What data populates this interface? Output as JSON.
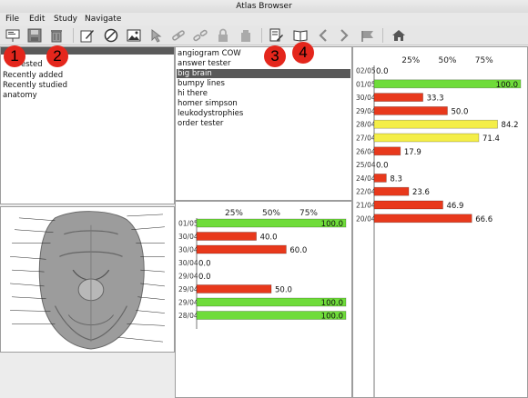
{
  "window": {
    "title": "Atlas Browser"
  },
  "menu": [
    "File",
    "Edit",
    "Study",
    "Navigate"
  ],
  "toolbar": {
    "icons": [
      "presentation-icon",
      "save-icon",
      "trash-icon",
      "edit-icon",
      "no-entry-icon",
      "image-icon",
      "cursor-icon",
      "link-icon",
      "unlink-icon",
      "lock-icon",
      "stack-icon",
      "notes-icon",
      "book-icon",
      "back-arrow-icon",
      "forward-arrow-icon",
      "flag-icon",
      "home-icon"
    ]
  },
  "markers": [
    "1",
    "2",
    "3",
    "4"
  ],
  "left_list": {
    "items": [
      "ested",
      "Recently added",
      "Recently studied",
      "anatomy"
    ]
  },
  "middle_list": {
    "items": [
      "angiogram COW",
      "answer tester",
      "big brain",
      "bumpy lines",
      "hi there",
      "homer simpson",
      "leukodystrophies",
      "order tester"
    ],
    "selected_index": 2
  },
  "colors": {
    "green": "#6fdc3a",
    "red": "#e8391c",
    "yellow": "#f4ee48",
    "selected": "#585858"
  },
  "chart_data": [
    {
      "type": "bar",
      "orientation": "horizontal",
      "axis_ticks": [
        "25%",
        "50%",
        "75%"
      ],
      "xlim": [
        0,
        100
      ],
      "categories": [
        "01/05",
        "30/04",
        "30/04",
        "30/04",
        "29/04",
        "29/04",
        "29/04",
        "28/04"
      ],
      "values": [
        100.0,
        40.0,
        60.0,
        0.0,
        0.0,
        50.0,
        100.0,
        100.0
      ],
      "value_labels": [
        "100.0",
        "40.0",
        "60.0",
        "0.0",
        "0.0",
        "50.0",
        "100.0",
        "100.0"
      ],
      "bar_colors": [
        "green",
        "red",
        "red",
        "red",
        "red",
        "red",
        "green",
        "green"
      ]
    },
    {
      "type": "bar",
      "orientation": "horizontal",
      "axis_ticks": [
        "25%",
        "50%",
        "75%"
      ],
      "xlim": [
        0,
        100
      ],
      "categories": [
        "02/05",
        "01/05",
        "30/04",
        "29/04",
        "28/04",
        "27/04",
        "26/04",
        "25/04",
        "24/04",
        "22/04",
        "21/04",
        "20/04"
      ],
      "values": [
        0.0,
        100.0,
        33.3,
        50.0,
        84.2,
        71.4,
        17.9,
        0.0,
        8.3,
        23.6,
        46.9,
        66.6
      ],
      "value_labels": [
        "0.0",
        "100.0",
        "33.3",
        "50.0",
        "84.2",
        "71.4",
        "17.9",
        "0.0",
        "8.3",
        "23.6",
        "46.9",
        "66.6"
      ],
      "bar_colors": [
        "red",
        "green",
        "red",
        "red",
        "yellow",
        "yellow",
        "red",
        "red",
        "red",
        "red",
        "red",
        "red"
      ]
    }
  ]
}
